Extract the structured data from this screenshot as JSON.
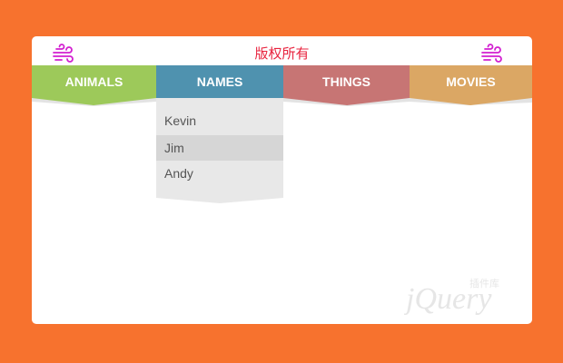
{
  "header": {
    "title": "版权所有"
  },
  "icons": {
    "left": "wind-icon",
    "right": "wind-icon",
    "icon_color": "#d21fd0"
  },
  "nav": {
    "tabs": [
      {
        "label": "ANIMALS",
        "color": "#9dc95a"
      },
      {
        "label": "NAMES",
        "color": "#4f92af"
      },
      {
        "label": "THINGS",
        "color": "#c77574"
      },
      {
        "label": "MOVIES",
        "color": "#dba764"
      }
    ],
    "active_tab": "NAMES"
  },
  "dropdown": {
    "items": [
      "Kevin",
      "Jim",
      "Andy"
    ],
    "highlighted": "Jim"
  },
  "watermark": {
    "text": "jQuery",
    "subtext": "插件库"
  },
  "colors": {
    "background": "#f7722e",
    "card": "#ffffff",
    "title": "#e8243f"
  }
}
